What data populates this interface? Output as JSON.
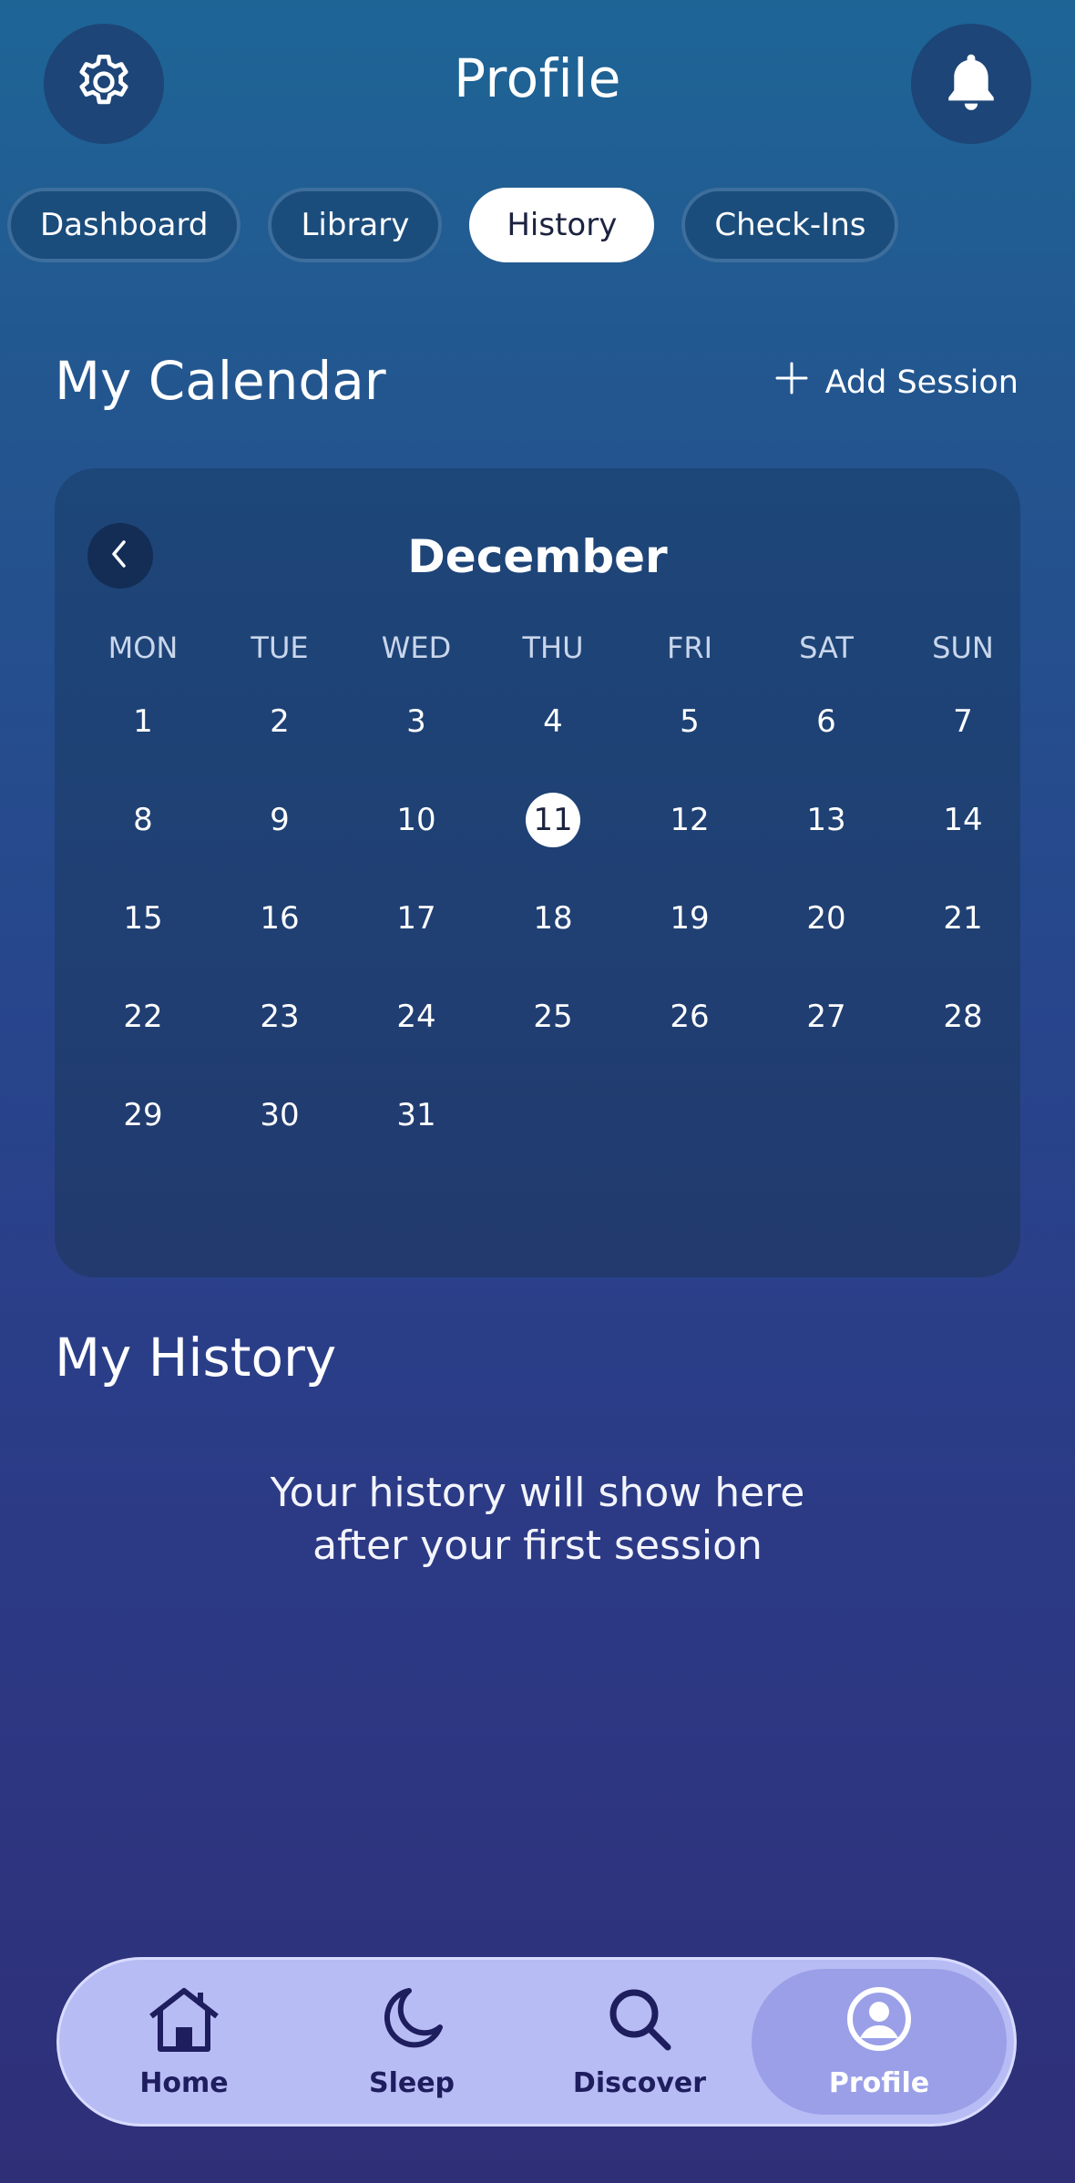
{
  "header": {
    "title": "Profile"
  },
  "tabs": [
    {
      "label": "Dashboard",
      "active": false
    },
    {
      "label": "Library",
      "active": false
    },
    {
      "label": "History",
      "active": true
    },
    {
      "label": "Check-Ins",
      "active": false
    }
  ],
  "calendar_section": {
    "title": "My Calendar",
    "add_session_label": "Add Session",
    "month": "December",
    "weekdays": [
      "MON",
      "TUE",
      "WED",
      "THU",
      "FRI",
      "SAT",
      "SUN"
    ],
    "weeks": [
      [
        "1",
        "2",
        "3",
        "4",
        "5",
        "6",
        "7"
      ],
      [
        "8",
        "9",
        "10",
        "11",
        "12",
        "13",
        "14"
      ],
      [
        "15",
        "16",
        "17",
        "18",
        "19",
        "20",
        "21"
      ],
      [
        "22",
        "23",
        "24",
        "25",
        "26",
        "27",
        "28"
      ],
      [
        "29",
        "30",
        "31",
        "",
        "",
        "",
        ""
      ]
    ],
    "selected_day": "11"
  },
  "history_section": {
    "title": "My History",
    "empty_line1": "Your history will show here",
    "empty_line2": "after your first session"
  },
  "nav": {
    "home": "Home",
    "sleep": "Sleep",
    "discover": "Discover",
    "profile": "Profile",
    "active": "profile"
  },
  "colors": {
    "nav_bg": "#b8bcf4",
    "nav_active": "#9a9fe8",
    "nav_text": "#1e1d5e",
    "card_bg": "#1d4679"
  }
}
